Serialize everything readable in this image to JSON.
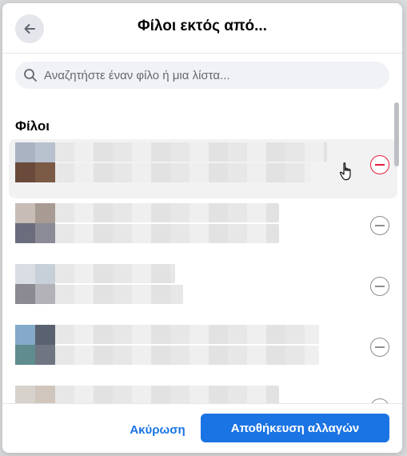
{
  "header": {
    "title": "Φίλοι εκτός από...",
    "back_icon": "arrow-left-icon"
  },
  "search": {
    "placeholder": "Αναζητήστε έναν φίλο ή μια λίστα...",
    "value": ""
  },
  "list": {
    "section_title": "Φίλοι",
    "items": [
      {
        "avatar_colors": [
          "#a9b3c2",
          "#b8c2cf",
          "#6a4a3a",
          "#7b5a46"
        ],
        "remove_state": "hover"
      },
      {
        "avatar_colors": [
          "#c7bdb6",
          "#a89b94",
          "#6b6d7d",
          "#8a8b96"
        ],
        "remove_state": "default"
      },
      {
        "avatar_colors": [
          "#d9dde4",
          "#c7d0d8",
          "#8b8a92",
          "#b3b2b8"
        ],
        "remove_state": "default"
      },
      {
        "avatar_colors": [
          "#84a9c9",
          "#5a6170",
          "#5f8c8f",
          "#6f7581"
        ],
        "remove_state": "default"
      },
      {
        "avatar_colors": [
          "#d8d2cc",
          "#d0c6bd",
          "#9c7d6c",
          "#7a5c4c"
        ],
        "remove_state": "default"
      }
    ]
  },
  "footer": {
    "cancel_label": "Ακύρωση",
    "save_label": "Αποθήκευση αλλαγών"
  },
  "colors": {
    "accent": "#1b74e4",
    "remove_active": "#e41e3f"
  }
}
